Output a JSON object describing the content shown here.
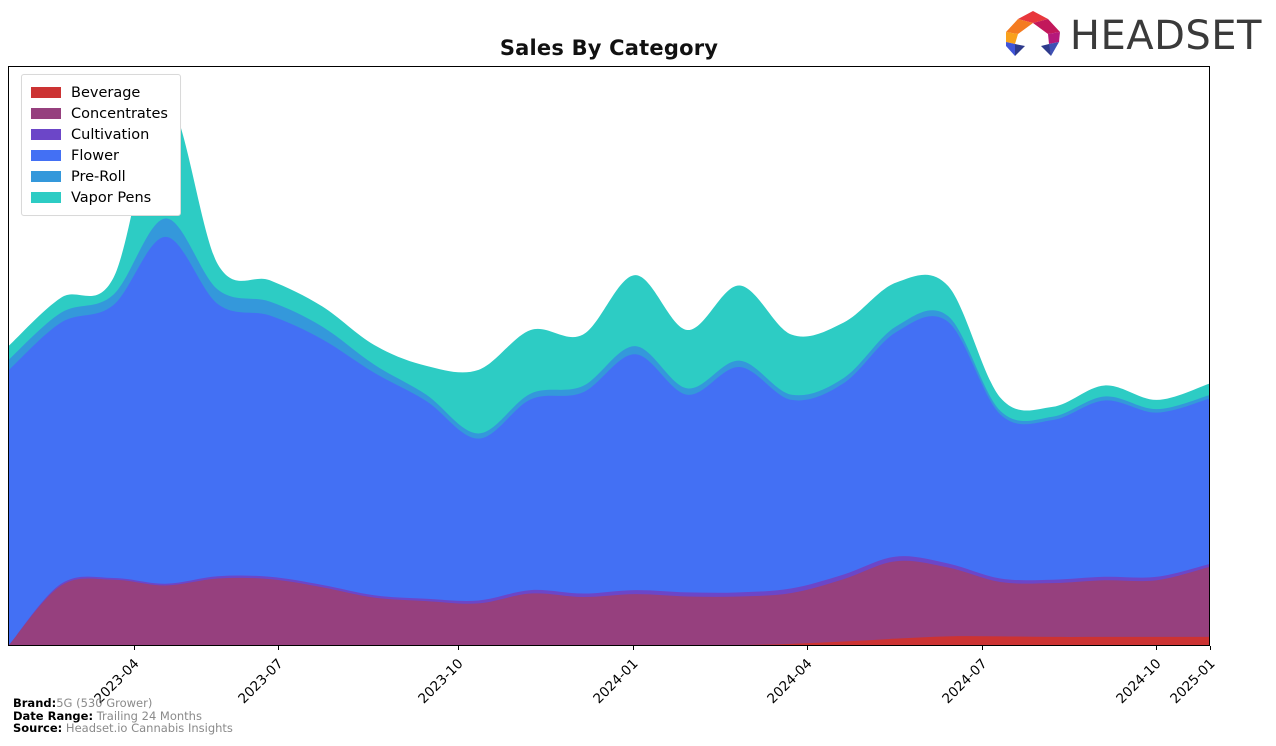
{
  "header": {
    "title": "Sales By Category",
    "brand_wordmark": "HEADSET",
    "logo_icon": "headset-logo-icon",
    "logo_colors": [
      "#E8373C",
      "#C2185B",
      "#F47B20",
      "#F9A11B",
      "#3F51B5",
      "#4054D8",
      "#7B3FA0",
      "#2E3A8C"
    ]
  },
  "legend": {
    "position": "upper-left",
    "items": [
      {
        "label": "Beverage",
        "color": "#CC3333"
      },
      {
        "label": "Concentrates",
        "color": "#96407E"
      },
      {
        "label": "Cultivation",
        "color": "#6C46C8"
      },
      {
        "label": "Flower",
        "color": "#4370F4"
      },
      {
        "label": "Pre-Roll",
        "color": "#3498DB"
      },
      {
        "label": "Vapor Pens",
        "color": "#2DCCC4"
      }
    ]
  },
  "footer": {
    "rows": [
      {
        "key": "Brand:",
        "value": "5G (530 Grower)"
      },
      {
        "key": "Date Range:",
        "value": "Trailing 24 Months"
      },
      {
        "key": "Source:",
        "value": "Headset.io Cannabis Insights"
      }
    ]
  },
  "chart_data": {
    "type": "area",
    "stacked": true,
    "title": "Sales By Category",
    "xlabel": "",
    "ylabel": "",
    "grid": false,
    "legend_position": "upper-left",
    "axis": {
      "x_tick_labels": [
        "2023-04",
        "2023-07",
        "2023-10",
        "2024-01",
        "2024-04",
        "2024-07",
        "2024-10",
        "2025-01"
      ],
      "x_tick_positions_pct": [
        10.5,
        22.5,
        37.4,
        52.0,
        66.5,
        81.0,
        95.5,
        100.0
      ],
      "y_tick_labels": [],
      "ylim": [
        0,
        100
      ]
    },
    "x": [
      "2023-01",
      "2023-02",
      "2023-03",
      "2023-04",
      "2023-05",
      "2023-06",
      "2023-07",
      "2023-08",
      "2023-09",
      "2023-10",
      "2023-11",
      "2023-12",
      "2024-01",
      "2024-02",
      "2024-03",
      "2024-04",
      "2024-05",
      "2024-06",
      "2024-07",
      "2024-08",
      "2024-09",
      "2024-10",
      "2024-11",
      "2024-12"
    ],
    "series": [
      {
        "name": "Beverage",
        "color": "#CC3333",
        "values": [
          0,
          0,
          0,
          0,
          0,
          0,
          0,
          0,
          0,
          0,
          0,
          0,
          0,
          0,
          0,
          0.2,
          0.6,
          1.1,
          1.5,
          1.5,
          1.4,
          1.4,
          1.4,
          1.4
        ]
      },
      {
        "name": "Concentrates",
        "color": "#96407E",
        "values": [
          0,
          10.3,
          11.3,
          10.3,
          11.5,
          11.4,
          10.0,
          8.2,
          7.6,
          7.2,
          8.9,
          8.3,
          8.8,
          8.4,
          8.4,
          8.8,
          10.8,
          13.4,
          11.9,
          9.4,
          9.3,
          9.8,
          9.8,
          12.1
        ]
      },
      {
        "name": "Cultivation",
        "color": "#6C46C8",
        "values": [
          0,
          0.3,
          0.3,
          0.3,
          0.4,
          0.4,
          0.4,
          0.4,
          0.4,
          0.5,
          0.6,
          0.6,
          0.7,
          0.7,
          0.7,
          0.8,
          0.8,
          0.8,
          0.7,
          0.6,
          0.6,
          0.6,
          0.6,
          0.5
        ]
      },
      {
        "name": "Flower",
        "color": "#4370F4",
        "values": [
          47.6,
          45.2,
          47.2,
          60.0,
          47.1,
          45.2,
          42.5,
          38.5,
          34.2,
          28.0,
          33.0,
          34.8,
          40.8,
          34.2,
          39.0,
          32.6,
          33.1,
          38.8,
          41.8,
          28.4,
          27.6,
          30.5,
          28.4,
          28.6
        ]
      },
      {
        "name": "Pre-Roll",
        "color": "#3498DB",
        "values": [
          1.8,
          1.7,
          1.8,
          3.2,
          2.5,
          2.4,
          2.2,
          1.4,
          1.1,
          0.9,
          1.0,
          1.1,
          1.4,
          1.1,
          1.1,
          0.9,
          0.9,
          1.0,
          1.0,
          0.6,
          0.6,
          0.7,
          0.6,
          0.6
        ]
      },
      {
        "name": "Vapor Pens",
        "color": "#2DCCC4",
        "values": [
          2.4,
          2.6,
          2.9,
          20.5,
          4.4,
          3.7,
          3.5,
          3.4,
          5.0,
          11.0,
          11.0,
          8.9,
          12.3,
          10.1,
          13.0,
          10.4,
          9.6,
          7.6,
          5.2,
          2.3,
          1.7,
          1.9,
          1.6,
          2.0
        ]
      }
    ]
  }
}
